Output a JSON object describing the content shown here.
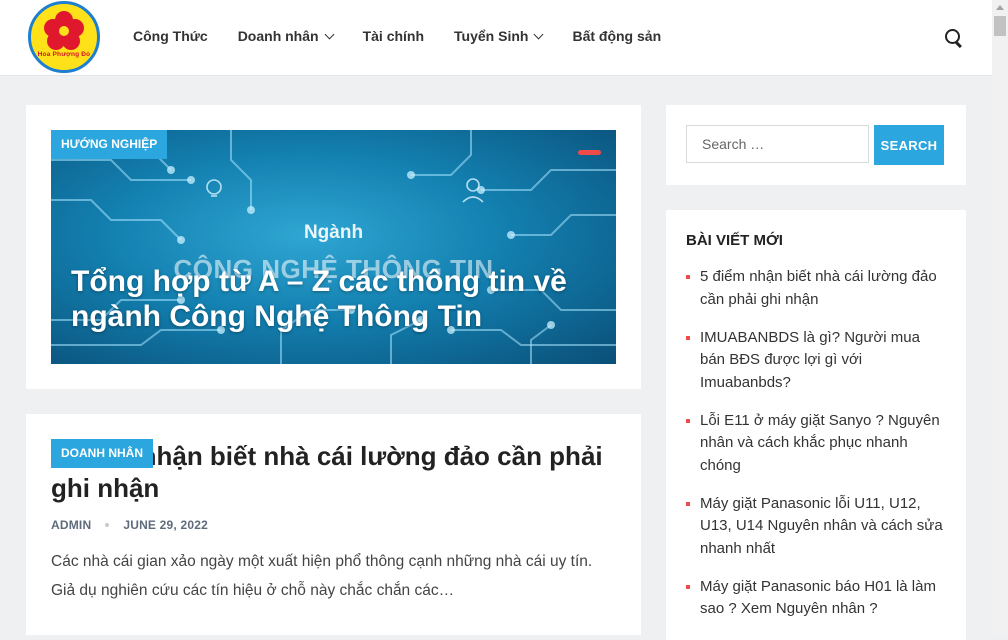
{
  "header": {
    "logo_text": "Hoa Phượng Đỏ",
    "nav": [
      {
        "label": "Công Thức",
        "has_dropdown": false
      },
      {
        "label": "Doanh nhân",
        "has_dropdown": true
      },
      {
        "label": "Tài chính",
        "has_dropdown": false
      },
      {
        "label": "Tuyển Sinh",
        "has_dropdown": true
      },
      {
        "label": "Bất động sản",
        "has_dropdown": false
      }
    ],
    "search_icon": "search-icon"
  },
  "featured": {
    "category": "HƯỚNG NGHIỆP",
    "image_text_1": "Ngành",
    "image_text_2": "CÔNG NGHỆ THÔNG TIN",
    "title": "Tổng hợp từ A – Z các thông tin về ngành Công Nghệ Thông Tin"
  },
  "post": {
    "category": "DOANH NHÂN",
    "title": "5 điểm nhận biết nhà cái lường đảo cần phải ghi nhận",
    "author": "ADMIN",
    "date": "JUNE 29, 2022",
    "excerpt": "Các nhà cái gian xảo ngày một xuất hiện phổ thông cạnh những nhà cái uy tín. Giả dụ nghiên cứu các tín hiệu ở chỗ này chắc chắn các…"
  },
  "sidebar": {
    "search_placeholder": "Search …",
    "search_button": "SEARCH",
    "recent_title": "BÀI VIẾT MỚI",
    "recent_posts": [
      "5 điểm nhận biết nhà cái lường đảo cần phải ghi nhận",
      "IMUABANBDS là gì? Người mua bán BĐS được lợi gì với Imuabanbds?",
      "Lỗi E11 ở máy giặt Sanyo ? Nguyên nhân và cách khắc phục nhanh chóng",
      "Máy giặt Panasonic lỗi U11, U12, U13, U14 Nguyên nhân và cách sửa nhanh nhất",
      "Máy giặt Panasonic báo H01 là làm sao ? Xem Nguyên nhân ?"
    ]
  },
  "colors": {
    "accent": "#2ba6de",
    "bullet": "#ef4b4b",
    "background": "#eef0f2"
  }
}
